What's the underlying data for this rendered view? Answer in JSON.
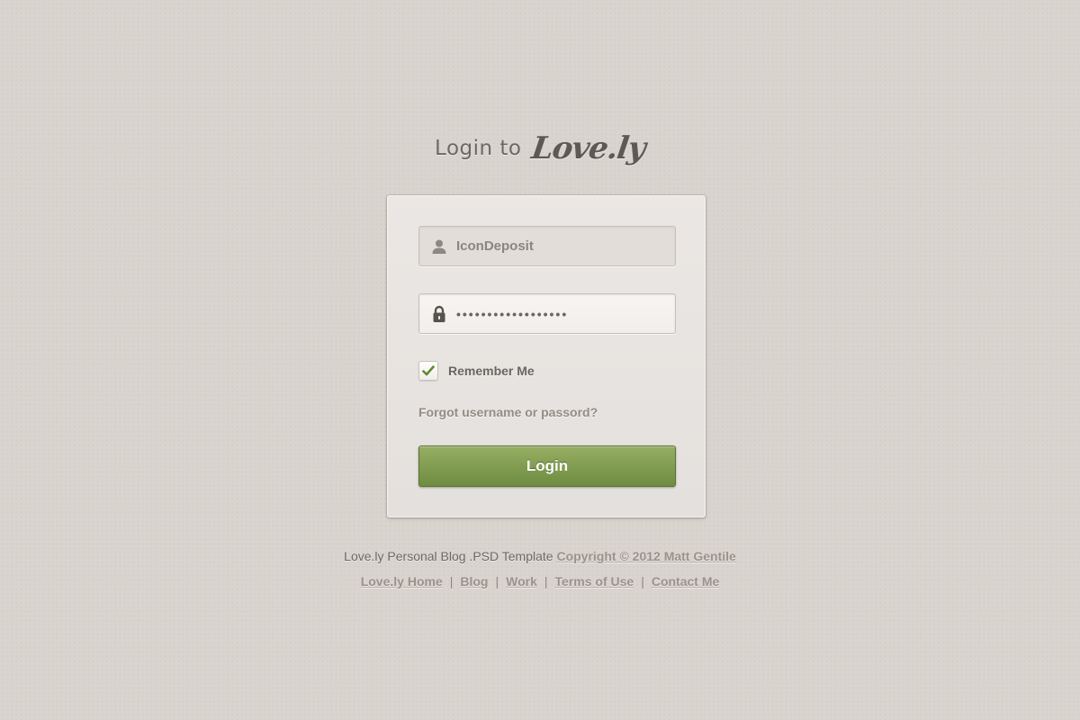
{
  "heading": {
    "prefix": "Login to",
    "brand": "Love.ly"
  },
  "form": {
    "username": {
      "value": "IconDeposit",
      "icon": "user-icon"
    },
    "password": {
      "value": "••••••••••••••••••",
      "icon": "lock-icon"
    },
    "remember": {
      "label": "Remember Me",
      "checked": true,
      "icon": "checkmark-icon"
    },
    "forgot_label": "Forgot username or passord?",
    "login_label": "Login"
  },
  "footer": {
    "template_text": "Love.ly Personal Blog .PSD Template",
    "copyright": "Copyright © 2012 Matt Gentile",
    "links": [
      {
        "label": "Love.ly Home"
      },
      {
        "label": "Blog"
      },
      {
        "label": "Work"
      },
      {
        "label": "Terms of Use"
      },
      {
        "label": "Contact Me"
      }
    ],
    "separator": "|"
  },
  "colors": {
    "background": "#d9d3ce",
    "card": "#e7e3e0",
    "accent_green": "#7f9a4c",
    "check_green": "#5e8a2e",
    "link": "#9a928b"
  }
}
